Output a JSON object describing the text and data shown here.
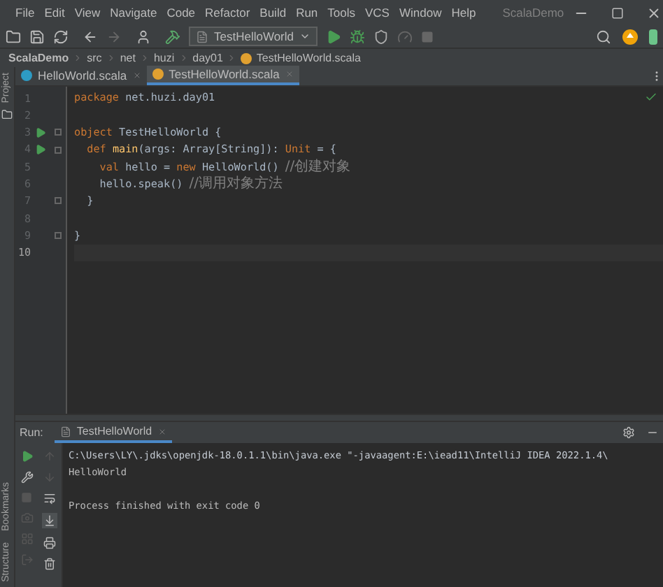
{
  "menu": {
    "items": [
      "File",
      "Edit",
      "View",
      "Navigate",
      "Code",
      "Refactor",
      "Build",
      "Run",
      "Tools",
      "VCS",
      "Window",
      "Help"
    ],
    "window_title": "ScalaDemo"
  },
  "toolbar": {
    "run_config": "TestHelloWorld"
  },
  "breadcrumbs": [
    "ScalaDemo",
    "src",
    "net",
    "huzi",
    "day01",
    "TestHelloWorld.scala"
  ],
  "tabs": [
    {
      "label": "HelloWorld.scala",
      "selected": false,
      "kind": "class"
    },
    {
      "label": "TestHelloWorld.scala",
      "selected": true,
      "kind": "object"
    }
  ],
  "side_tools": {
    "top": [
      "Project"
    ],
    "bottom": [
      "Bookmarks",
      "Structure"
    ]
  },
  "editor": {
    "lines": [
      {
        "number": "1",
        "run_marker": false,
        "fold": false,
        "current": false,
        "tokens": [
          {
            "kind": "keyword",
            "text": "package "
          },
          {
            "kind": "plain",
            "text": "net.huzi.day01"
          }
        ]
      },
      {
        "number": "2",
        "run_marker": false,
        "fold": false,
        "current": false
      },
      {
        "number": "3",
        "run_marker": true,
        "fold": true,
        "current": false,
        "tokens": [
          {
            "kind": "keyword",
            "text": "object "
          },
          {
            "kind": "plain",
            "text": "TestHelloWorld {"
          }
        ]
      },
      {
        "number": "4",
        "run_marker": true,
        "fold": true,
        "current": false,
        "tokens": [
          {
            "kind": "keyword",
            "text": "  def "
          },
          {
            "kind": "function",
            "text": "main"
          },
          {
            "kind": "plain",
            "text": "(args: Array[String]): "
          },
          {
            "kind": "keyword",
            "text": "Unit"
          },
          {
            "kind": "plain",
            "text": " = {"
          }
        ]
      },
      {
        "number": "5",
        "run_marker": false,
        "fold": false,
        "current": false,
        "tokens": [
          {
            "kind": "keyword",
            "text": "    val "
          },
          {
            "kind": "plain",
            "text": "hello = "
          },
          {
            "kind": "keyword",
            "text": "new "
          },
          {
            "kind": "plain",
            "text": "HelloWorld() "
          },
          {
            "kind": "comment",
            "text": "//创建对象"
          }
        ]
      },
      {
        "number": "6",
        "run_marker": false,
        "fold": false,
        "current": false,
        "tokens": [
          {
            "kind": "plain",
            "text": "    hello.speak() "
          },
          {
            "kind": "comment",
            "text": "//调用对象方法"
          }
        ]
      },
      {
        "number": "7",
        "run_marker": false,
        "fold": true,
        "current": false,
        "tokens": [
          {
            "kind": "plain",
            "text": "  }"
          }
        ]
      },
      {
        "number": "8",
        "run_marker": false,
        "fold": false,
        "current": false
      },
      {
        "number": "9",
        "run_marker": false,
        "fold": true,
        "current": false,
        "tokens": [
          {
            "kind": "plain",
            "text": "}"
          }
        ]
      },
      {
        "number": "10",
        "run_marker": false,
        "fold": false,
        "current": true
      }
    ]
  },
  "run_panel": {
    "label": "Run:",
    "tab": "TestHelloWorld",
    "output": [
      {
        "kind": "command",
        "text": "C:\\Users\\LY\\.jdks\\openjdk-18.0.1.1\\bin\\java.exe \"-javaagent:E:\\iead11\\IntelliJ IDEA 2022.1.4\\"
      },
      {
        "kind": "text",
        "text": "HelloWorld"
      },
      {
        "kind": "blank"
      },
      {
        "kind": "text",
        "text": "Process finished with exit code 0"
      }
    ]
  }
}
